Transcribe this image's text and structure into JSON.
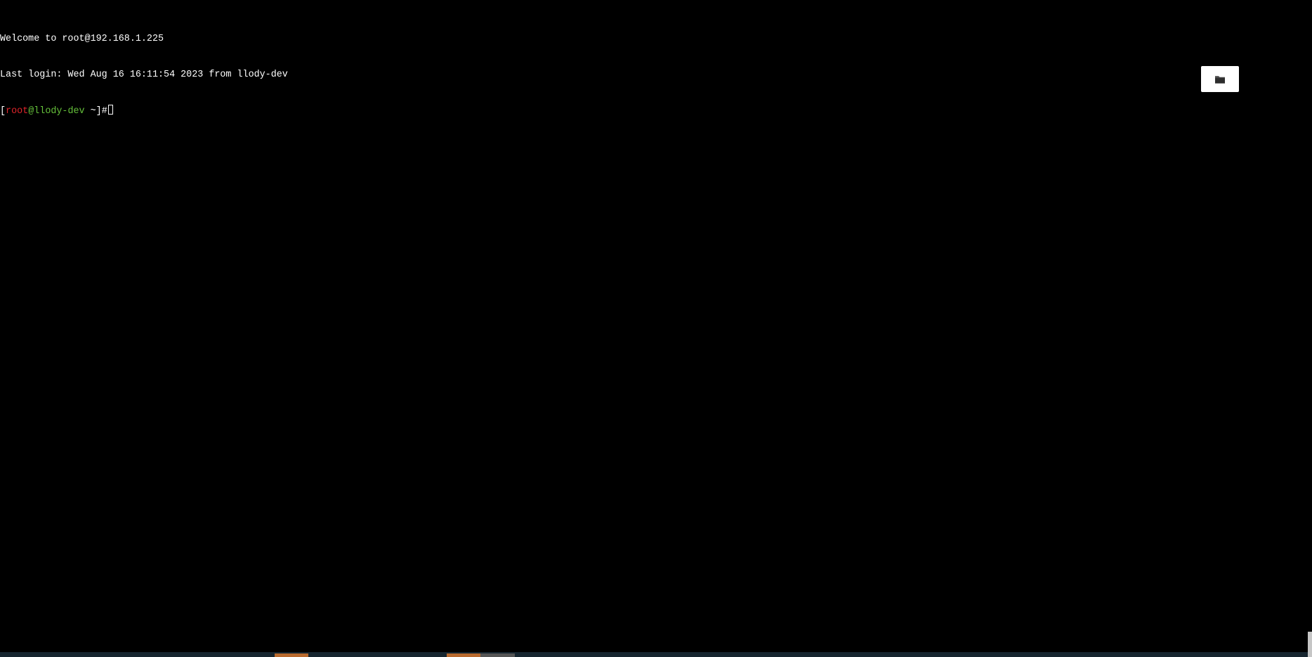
{
  "terminal": {
    "welcome_line": "Welcome to root@192.168.1.225",
    "last_login_line": "Last login: Wed Aug 16 16:11:54 2023 from llody-dev",
    "prompt": {
      "open_bracket": "[",
      "user": "root",
      "at": "@",
      "host": "llody-dev",
      "path": " ~",
      "close_bracket": "]",
      "symbol": "#"
    }
  },
  "toolbar": {
    "file_manager_icon": "folder-icon"
  },
  "colors": {
    "background": "#000000",
    "text": "#ffffff",
    "prompt_user": "#e0242a",
    "prompt_host": "#66c23b",
    "tab_active": "#b96a2e",
    "tab_inactive": "#555555",
    "bottom_bar": "#16252f"
  }
}
